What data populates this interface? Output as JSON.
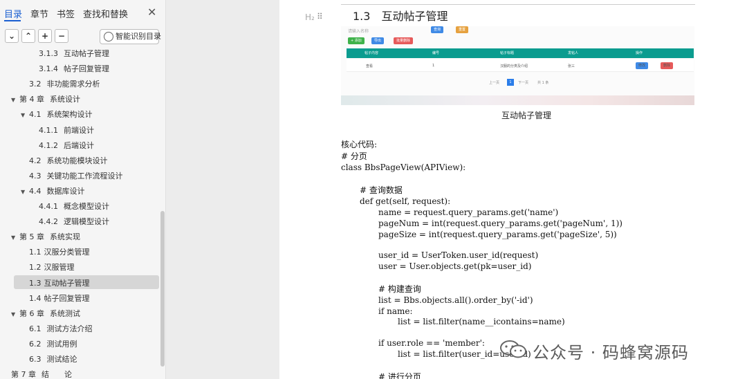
{
  "sidebar": {
    "tabs": [
      {
        "label": "目录",
        "active": true
      },
      {
        "label": "章节",
        "active": false
      },
      {
        "label": "书签",
        "active": false
      },
      {
        "label": "查找和替换",
        "active": false
      }
    ],
    "close": "✕",
    "toolbar": {
      "collapse": "⌄",
      "expand": "⌃",
      "add": "+",
      "remove": "−",
      "smart_label": "智能识别目录"
    },
    "toc": [
      {
        "num": "3.1.3",
        "text": "互动帖子管理",
        "level": 3
      },
      {
        "num": "3.1.4",
        "text": "帖子回复管理",
        "level": 3
      },
      {
        "num": "3.2",
        "text": "非功能需求分析",
        "level": 2
      },
      {
        "num": "第 4 章",
        "text": "系统设计",
        "level": 1,
        "caret": true
      },
      {
        "num": "4.1",
        "text": "系统架构设计",
        "level": 2,
        "caret": true
      },
      {
        "num": "4.1.1",
        "text": "前端设计",
        "level": 3
      },
      {
        "num": "4.1.2",
        "text": "后端设计",
        "level": 3
      },
      {
        "num": "4.2",
        "text": "系统功能模块设计",
        "level": 2
      },
      {
        "num": "4.3",
        "text": "关键功能工作流程设计",
        "level": 2
      },
      {
        "num": "4.4",
        "text": "数据库设计",
        "level": 2,
        "caret": true
      },
      {
        "num": "4.4.1",
        "text": "概念模型设计",
        "level": 3
      },
      {
        "num": "4.4.2",
        "text": "逻辑模型设计",
        "level": 3
      },
      {
        "num": "第 5 章",
        "text": "系统实现",
        "level": 1,
        "caret": true
      },
      {
        "num": "1.1",
        "text": "汉服分类管理",
        "level": 2,
        "tight": true
      },
      {
        "num": "1.2",
        "text": "汉服管理",
        "level": 2,
        "tight": true
      },
      {
        "num": "1.3",
        "text": "互动帖子管理",
        "level": 2,
        "tight": true,
        "selected": true
      },
      {
        "num": "1.4",
        "text": "帖子回复管理",
        "level": 2,
        "tight": true
      },
      {
        "num": "第 6 章",
        "text": "系统测试",
        "level": 1,
        "caret": true
      },
      {
        "num": "6.1",
        "text": "测试方法介绍",
        "level": 2
      },
      {
        "num": "6.2",
        "text": "测试用例",
        "level": 2
      },
      {
        "num": "6.3",
        "text": "测试结论",
        "level": 2
      },
      {
        "num": "第 7 章",
        "text": "结　　论",
        "level": 1
      }
    ]
  },
  "doc": {
    "heading_marker": "H₂",
    "grip": "⠿",
    "heading_num": "1.3",
    "heading_text": "互动帖子管理",
    "screenshot": {
      "search_placeholder": "请输入名称",
      "buttons": {
        "search": "查询",
        "reset": "重置",
        "add": "+ 添加",
        "export": "导出",
        "batch_delete": "批量删除"
      },
      "columns": [
        "帖子内容",
        "编号",
        "帖子标题",
        "发帖人",
        "操作"
      ],
      "row": {
        "view": "查看",
        "id": "1",
        "title": "汉服的分类及介绍",
        "author": "张三",
        "edit": "修改",
        "delete": "删除"
      },
      "pager": {
        "prev": "上一页",
        "current": "1",
        "next": "下一页",
        "total": "共 1 条"
      }
    },
    "caption": "互动帖子管理",
    "code": [
      "核心代码:",
      "# 分页",
      "class BbsPageView(APIView):",
      "# 查询数据",
      "def get(self, request):",
      "name = request.query_params.get('name')",
      "pageNum = int(request.query_params.get('pageNum', 1))",
      "pageSize = int(request.query_params.get('pageSize', 5))",
      "user_id = UserToken.user_id(request)",
      "user = User.objects.get(pk=user_id)",
      "# 构建查询",
      "list = Bbs.objects.all().order_by('-id')",
      "if name:",
      "list = list.filter(name__icontains=name)",
      "if user.role == 'member':",
      "list = list.filter(user_id=user.id)",
      "# 进行分页"
    ]
  },
  "watermark": {
    "text": "公众号 · 码蜂窝源码",
    "icon": "wechat-icon"
  }
}
